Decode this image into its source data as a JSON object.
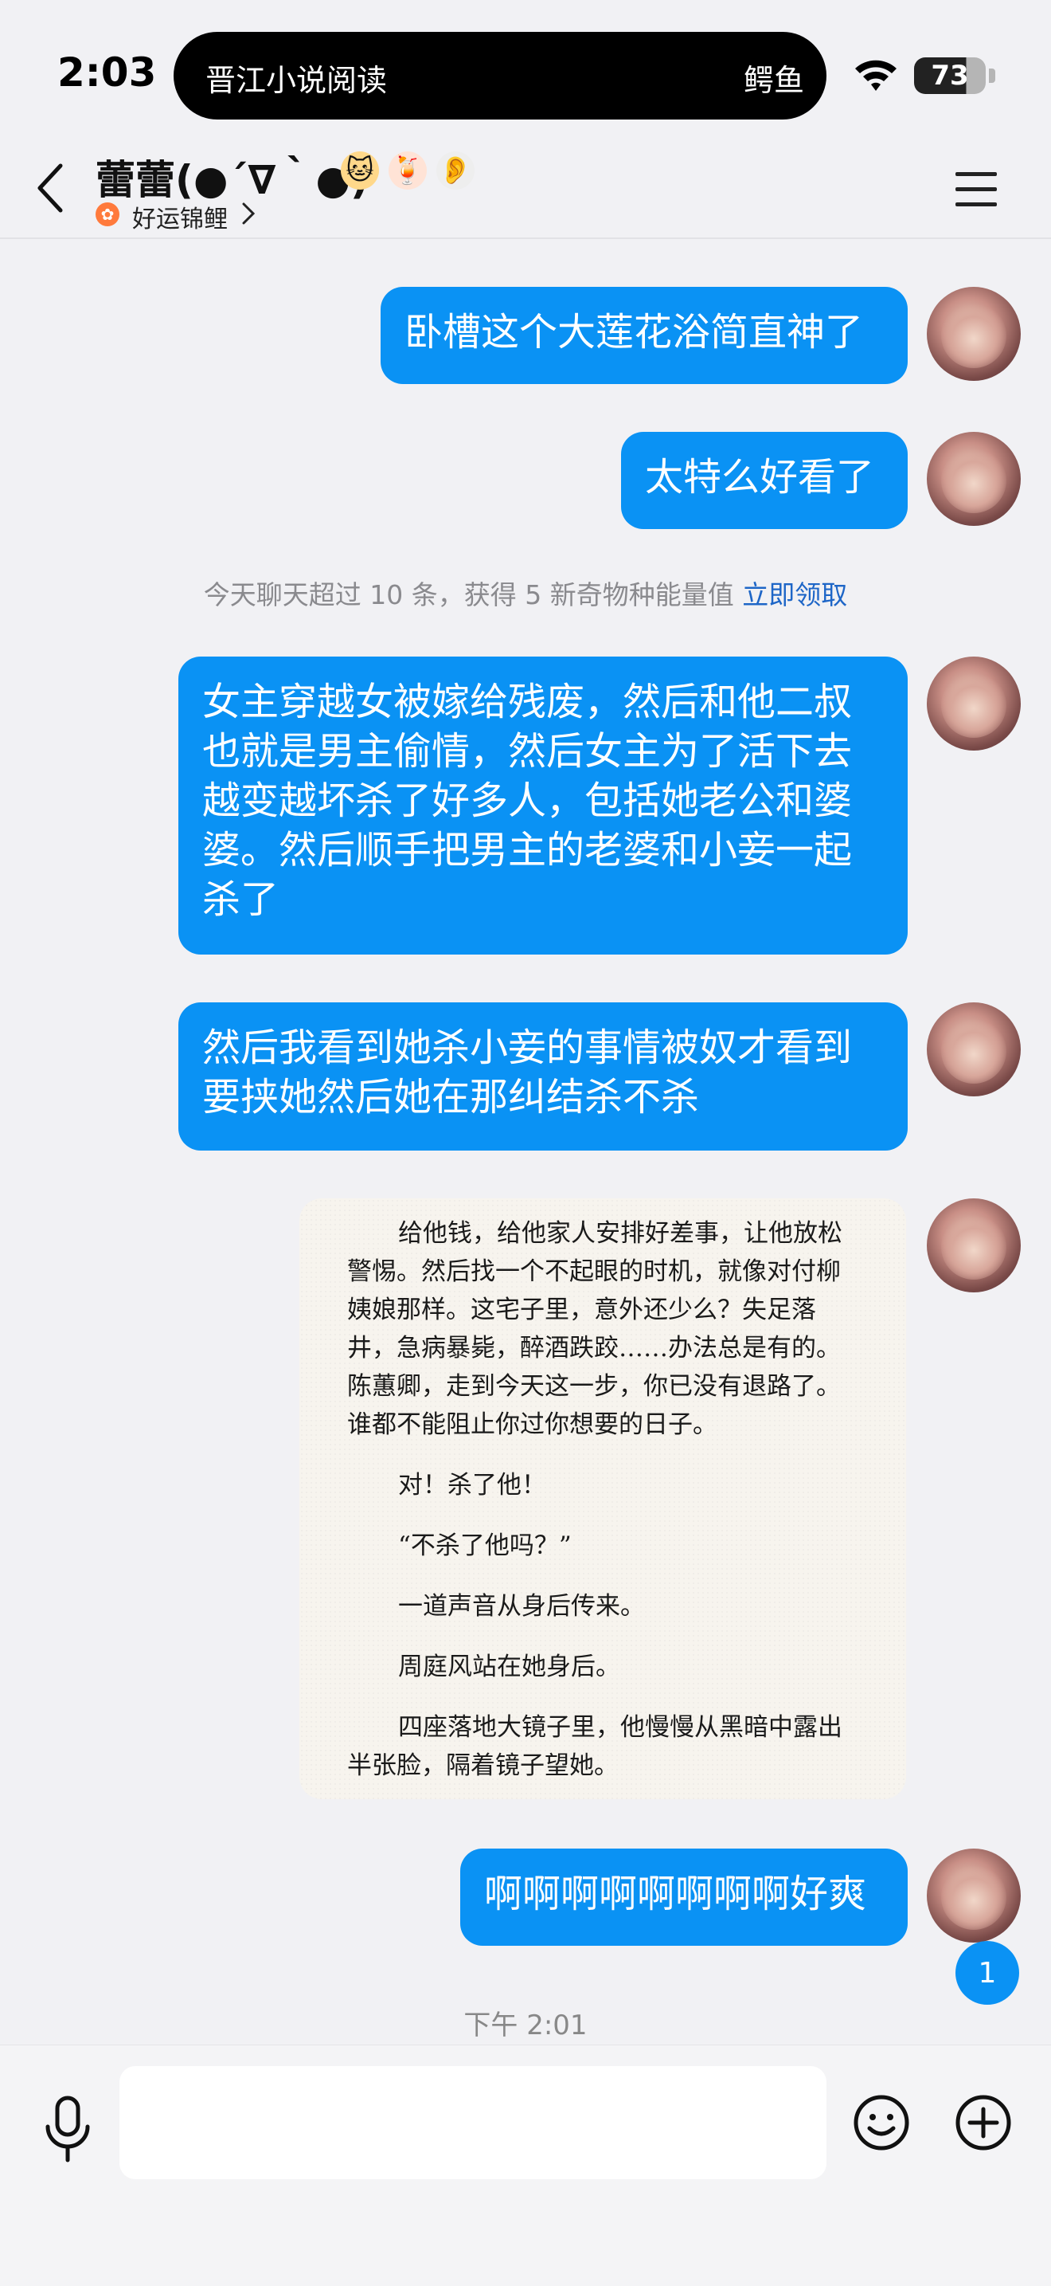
{
  "status_bar": {
    "time": "2:03",
    "island_app": "晋江小说阅读",
    "island_source": "鳄鱼",
    "battery": "73"
  },
  "header": {
    "contact_name": "蕾蕾(●´∇｀●)",
    "badges": [
      "🐱",
      "🍹",
      "👂"
    ],
    "subtitle": "好运锦鲤"
  },
  "messages": [
    {
      "text": "卧槽这个大莲花浴简直神了"
    },
    {
      "text": "太特么好看了"
    },
    {
      "lines": [
        "女主穿越女被嫁给残废，然后和他二叔",
        "也就是男主偷情，然后女主为了活下去",
        "越变越坏杀了好多人，包括她老公和婆",
        "婆。然后顺手把男主的老婆和小妾一起",
        "杀了"
      ]
    },
    {
      "lines": [
        "然后我看到她杀小妾的事情被奴才看到",
        "要挟她然后她在那纠结杀不杀"
      ]
    },
    {
      "text": "啊啊啊啊啊啊啊啊好爽"
    }
  ],
  "system_note": {
    "text": "今天聊天超过 10 条，获得 5 新奇物种能量值",
    "action": "立即领取"
  },
  "novel_excerpt": [
    "给他钱，给他家人安排好差事，让他放松警惕。然后找一个不起眼的时机，就像对付柳姨娘那样。这宅子里，意外还少么？失足落井，急病暴毙，醉酒跌跤……办法总是有的。陈蕙卿，走到今天这一步，你已没有退路了。谁都不能阻止你过你想要的日子。",
    "对！杀了他！",
    "“不杀了他吗？”",
    "一道声音从身后传来。",
    "周庭风站在她身后。",
    "四座落地大镜子里，他慢慢从黑暗中露出半张脸，隔着镜子望她。"
  ],
  "unread_count": "1",
  "timestamp": "下午 2:01",
  "input": {
    "value": "",
    "placeholder": ""
  },
  "colors": {
    "bubble": "#0a92f4",
    "link": "#1e66c7",
    "background": "#f1f1f4"
  }
}
